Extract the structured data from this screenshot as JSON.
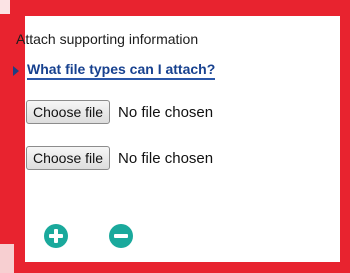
{
  "attach": {
    "heading": "Attach supporting information",
    "help_link": "What file types can I attach?"
  },
  "file_inputs": [
    {
      "button_label": "Choose file",
      "status": "No file chosen"
    },
    {
      "button_label": "Choose file",
      "status": "No file chosen"
    }
  ],
  "controls": {
    "add_icon": "plus-circle-icon",
    "remove_icon": "minus-circle-icon"
  },
  "colors": {
    "frame": "#e8232f",
    "link": "#17418f",
    "accent": "#1aa99c"
  }
}
